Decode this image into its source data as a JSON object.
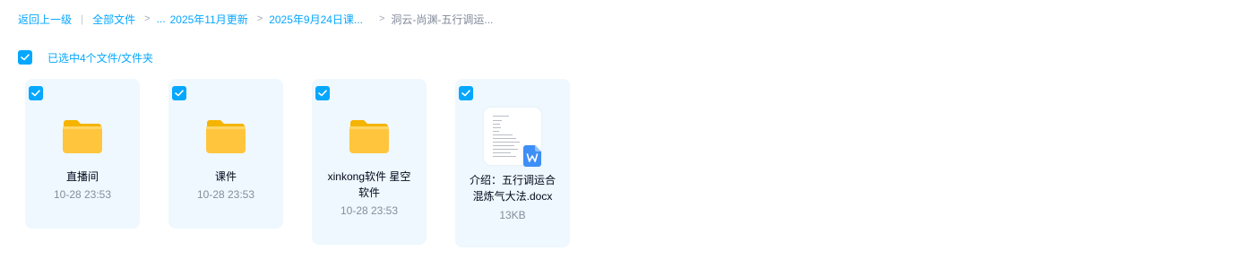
{
  "breadcrumb": {
    "back": "返回上一级",
    "all_files": "全部文件",
    "ellipsis": "...",
    "items": [
      "2025年11月更新",
      "2025年9月24日课...",
      "洞云-尚渊-五行调运..."
    ]
  },
  "selection": {
    "text": "已选中4个文件/文件夹"
  },
  "files": [
    {
      "name": "直播间",
      "meta": "10-28 23:53",
      "type": "folder",
      "selected": true
    },
    {
      "name": "课件",
      "meta": "10-28 23:53",
      "type": "folder",
      "selected": true
    },
    {
      "name": "xinkong软件 星空软件",
      "meta": "10-28 23:53",
      "type": "folder",
      "selected": true
    },
    {
      "name": "介绍：五行调运合混炼气大法.docx",
      "meta": "13KB",
      "type": "docx",
      "selected": true
    }
  ],
  "colors": {
    "accent": "#06a7ff",
    "card_bg": "#eef8fe",
    "folder": "#ffc53d",
    "word_badge": "#3e8ef7"
  }
}
